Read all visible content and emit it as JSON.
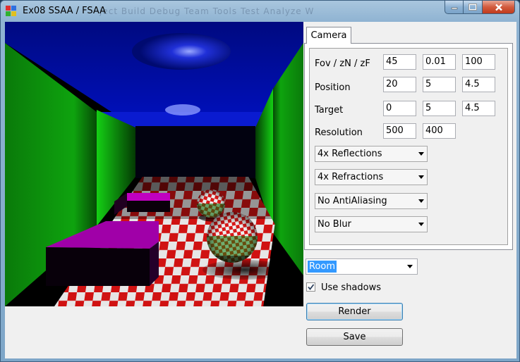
{
  "window": {
    "title": "Ex08 SSAA / FSAA",
    "background_menu_ghost": "ject   Build   Debug   Team   Tools   Test   Analyze   W"
  },
  "viewport": {
    "colors": {
      "ceiling": "#0010a0",
      "wall": "#0a8a0a",
      "floor_red": "#d01010",
      "floor_white": "#e8e8e8",
      "box": "#b000b0"
    }
  },
  "tabs": [
    {
      "label": "Camera"
    }
  ],
  "camera": {
    "fov_label": "Fov / zN / zF",
    "fov": "45",
    "znear": "0.01",
    "zfar": "100",
    "position_label": "Position",
    "pos_x": "20",
    "pos_y": "5",
    "pos_z": "4.5",
    "target_label": "Target",
    "tgt_x": "0",
    "tgt_y": "5",
    "tgt_z": "4.5",
    "resolution_label": "Resolution",
    "res_w": "500",
    "res_h": "400"
  },
  "options": {
    "reflections": "4x Reflections",
    "refractions": "4x Refractions",
    "antialiasing": "No AntiAliasing",
    "blur": "No Blur"
  },
  "scene": {
    "selected": "Room"
  },
  "shadows": {
    "label": "Use shadows",
    "checked": true
  },
  "buttons": {
    "render": "Render",
    "save": "Save"
  }
}
